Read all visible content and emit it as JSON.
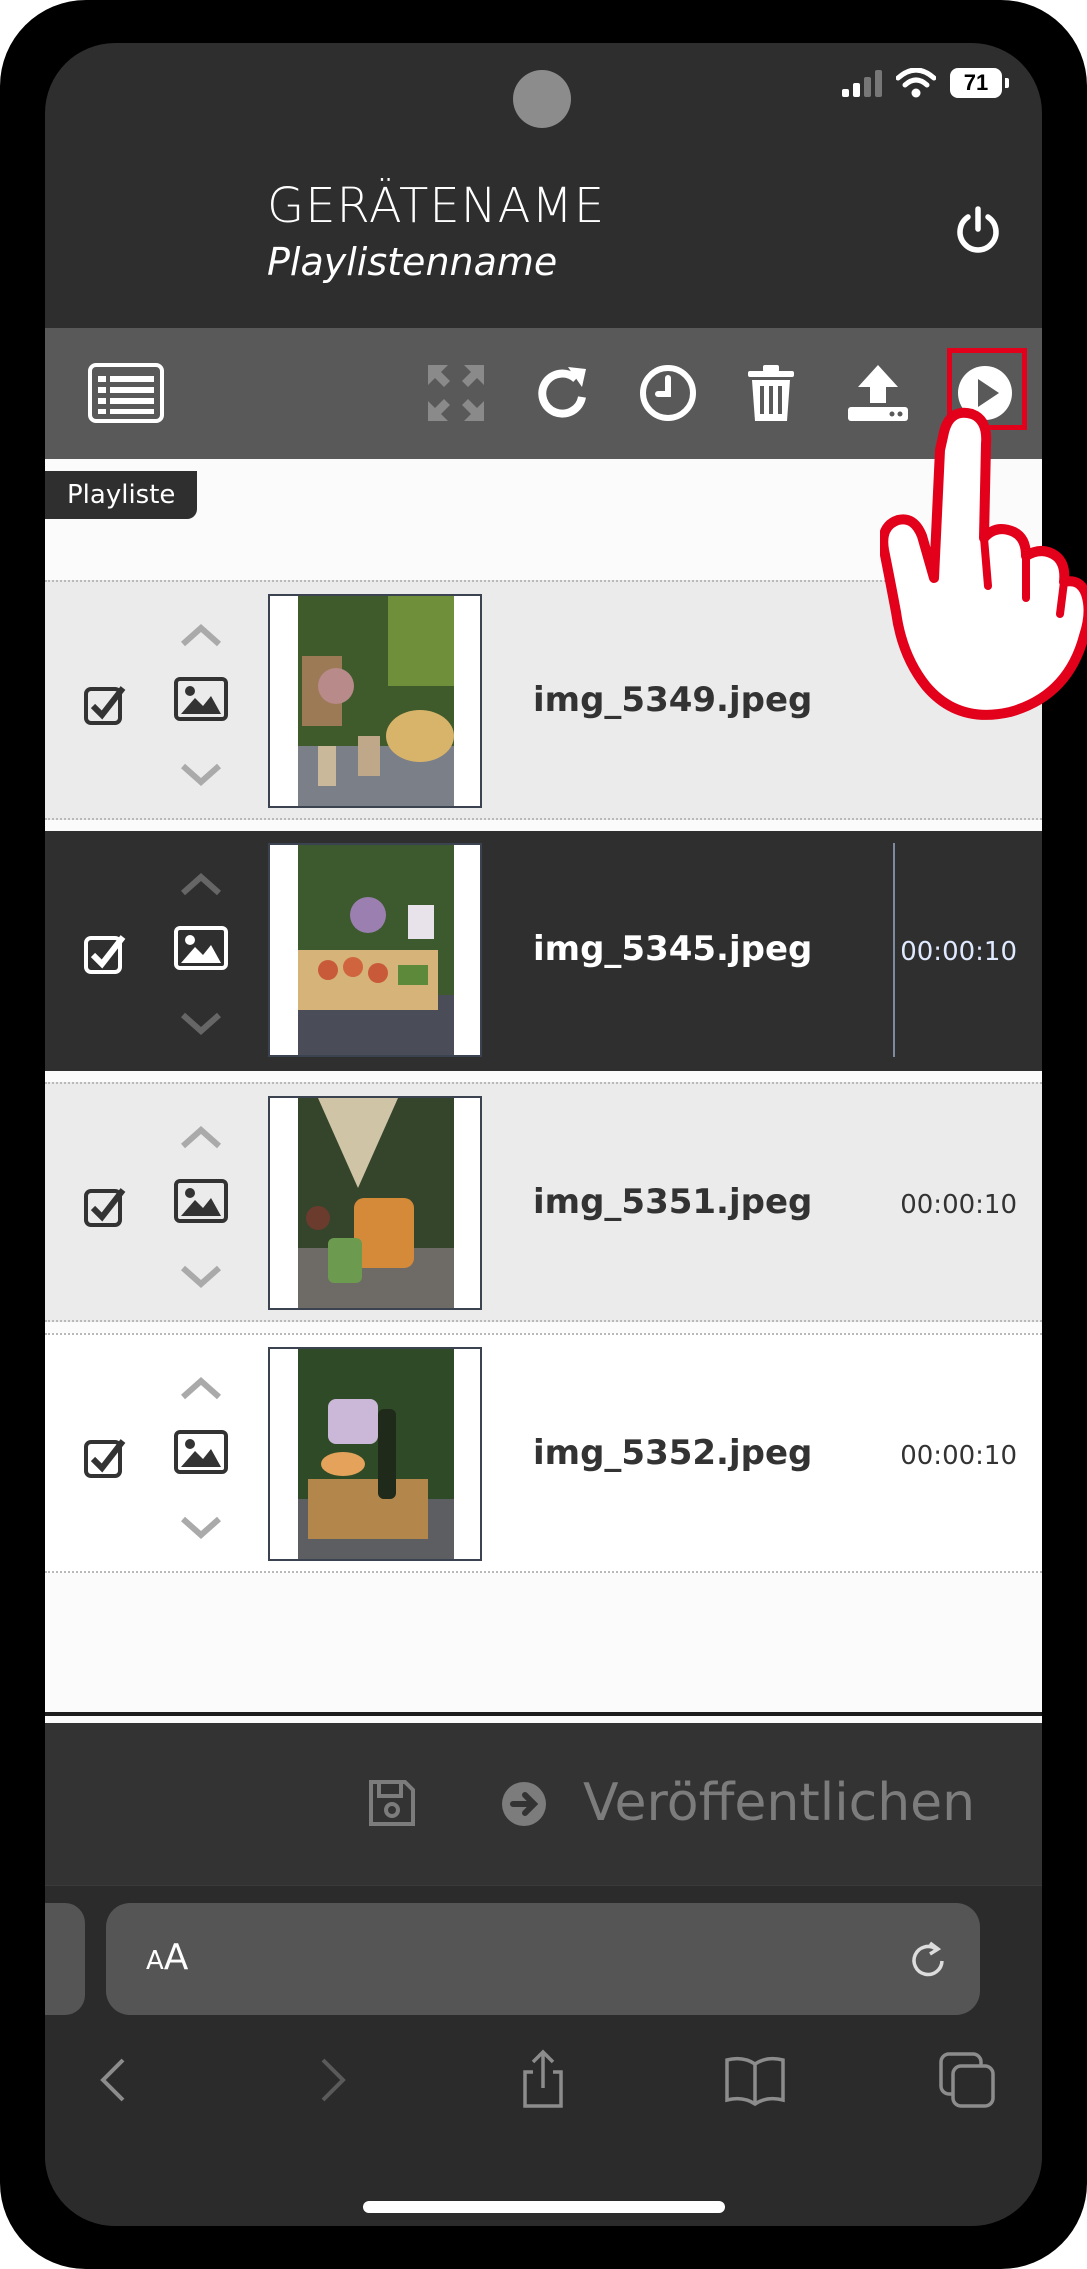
{
  "status_bar": {
    "battery": "71"
  },
  "header": {
    "device_name": "GERÄTENAME",
    "playlist_name": "Playlistenname"
  },
  "toolbar": {
    "icons": [
      "list-icon",
      "fullscreen-icon",
      "refresh-icon",
      "clock-icon",
      "trash-icon",
      "upload-icon",
      "play-icon"
    ],
    "highlighted": "play-icon",
    "accent": "#e3001b"
  },
  "playlist": {
    "tag": "Playliste",
    "items": [
      {
        "filename": "img_5349.jpeg",
        "duration": "",
        "checked": true,
        "style": "light"
      },
      {
        "filename": "img_5345.jpeg",
        "duration": "00:00:10",
        "checked": true,
        "style": "dark"
      },
      {
        "filename": "img_5351.jpeg",
        "duration": "00:00:10",
        "checked": true,
        "style": "light"
      },
      {
        "filename": "img_5352.jpeg",
        "duration": "00:00:10",
        "checked": true,
        "style": "white"
      }
    ]
  },
  "action_bar": {
    "publish_label": "Veröffentlichen"
  },
  "browser": {
    "aa_small": "A",
    "aa_large": "A"
  }
}
